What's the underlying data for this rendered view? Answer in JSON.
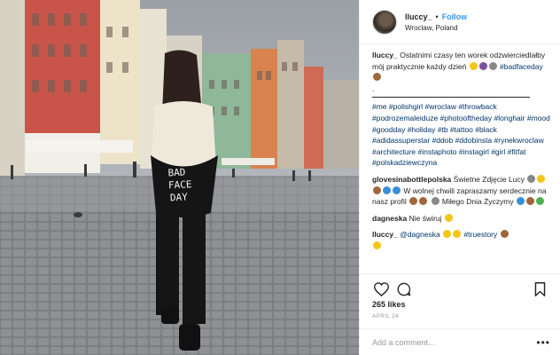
{
  "post": {
    "username": "lluccy_",
    "follow_label": "Follow",
    "location": "Wroclaw, Poland",
    "dot": "•"
  },
  "caption": {
    "user": "lluccy_",
    "text": "Ostatnimi czasy ten worek odzwierciedlałby mój praktycznie każdy dzień",
    "tag_badface": "#badfaceday",
    "period": ".",
    "hashtags": "#me #polishgirl #wroclaw #throwback #podrozemaleiduze #photooftheday #longhair #mood #goodday #holiday #tb #tattoo #black #adidassuperstar #ddob #ddobinsta #rynekwroclaw #architecture #instaphoto #instagirl #girl #fitfat #polskadziewczyna"
  },
  "comments": [
    {
      "user": "glovesinabottlepolska",
      "text1": "Świetne Zdjęcie Lucy",
      "text2": "W wolnej chwili zapraszamy serdecznie na nasz profil",
      "text3": "Miłego Dnia Życzymy"
    },
    {
      "user": "dagneska",
      "text": "Nie świruj"
    },
    {
      "user": "lluccy_",
      "mention": "@dagneska",
      "tag": "#truestory"
    }
  ],
  "likes": "265 likes",
  "date": "APRIL 24",
  "add_comment_placeholder": "Add a comment...",
  "more_label": "•••",
  "bag_text": "BAD FACE DAY",
  "icons": [
    "heart-icon",
    "comment-icon",
    "bookmark-icon"
  ],
  "colors": {
    "link": "#3897f0",
    "hashtag": "#003569"
  }
}
